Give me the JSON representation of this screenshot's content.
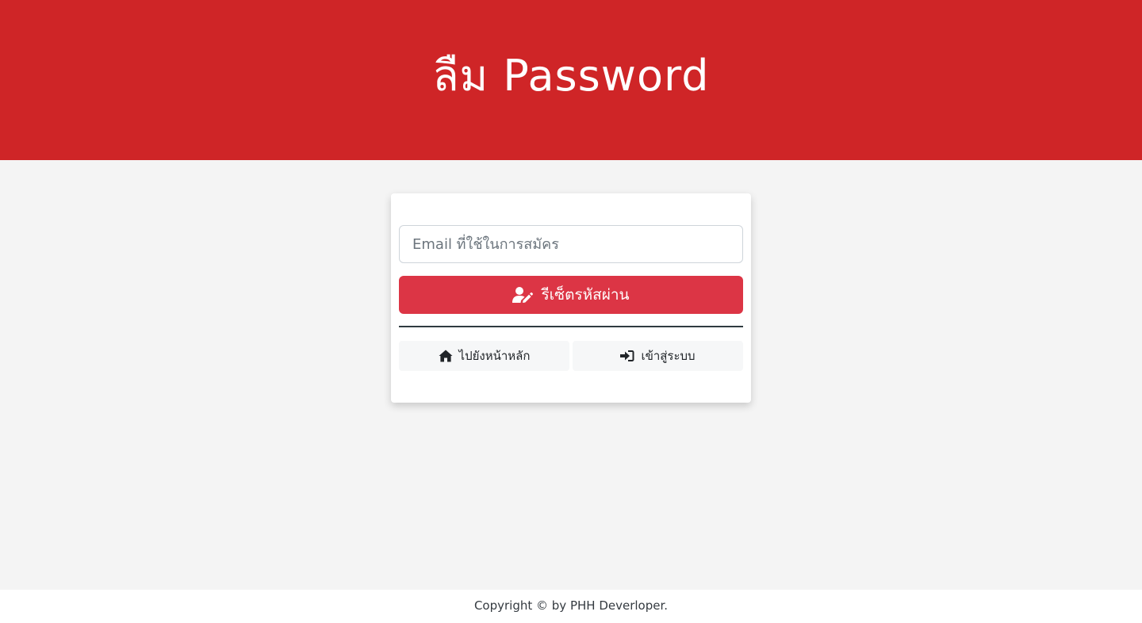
{
  "hero": {
    "title": "ลืม Password",
    "background": "#cf2527"
  },
  "form": {
    "email_value": "",
    "email_placeholder": "Email ที่ใช้ในการสมัคร",
    "submit_label": "รีเซ็ตรหัสผ่าน",
    "submit_icon": "user-edit-icon",
    "submit_color": "#dc3545"
  },
  "links": {
    "home_label": "ไปยังหน้าหลัก",
    "home_icon": "home-icon",
    "login_label": "เข้าสู่ระบบ",
    "login_icon": "sign-in-icon"
  },
  "footer": {
    "copyright": "Copyright © by PHH Deverloper."
  }
}
